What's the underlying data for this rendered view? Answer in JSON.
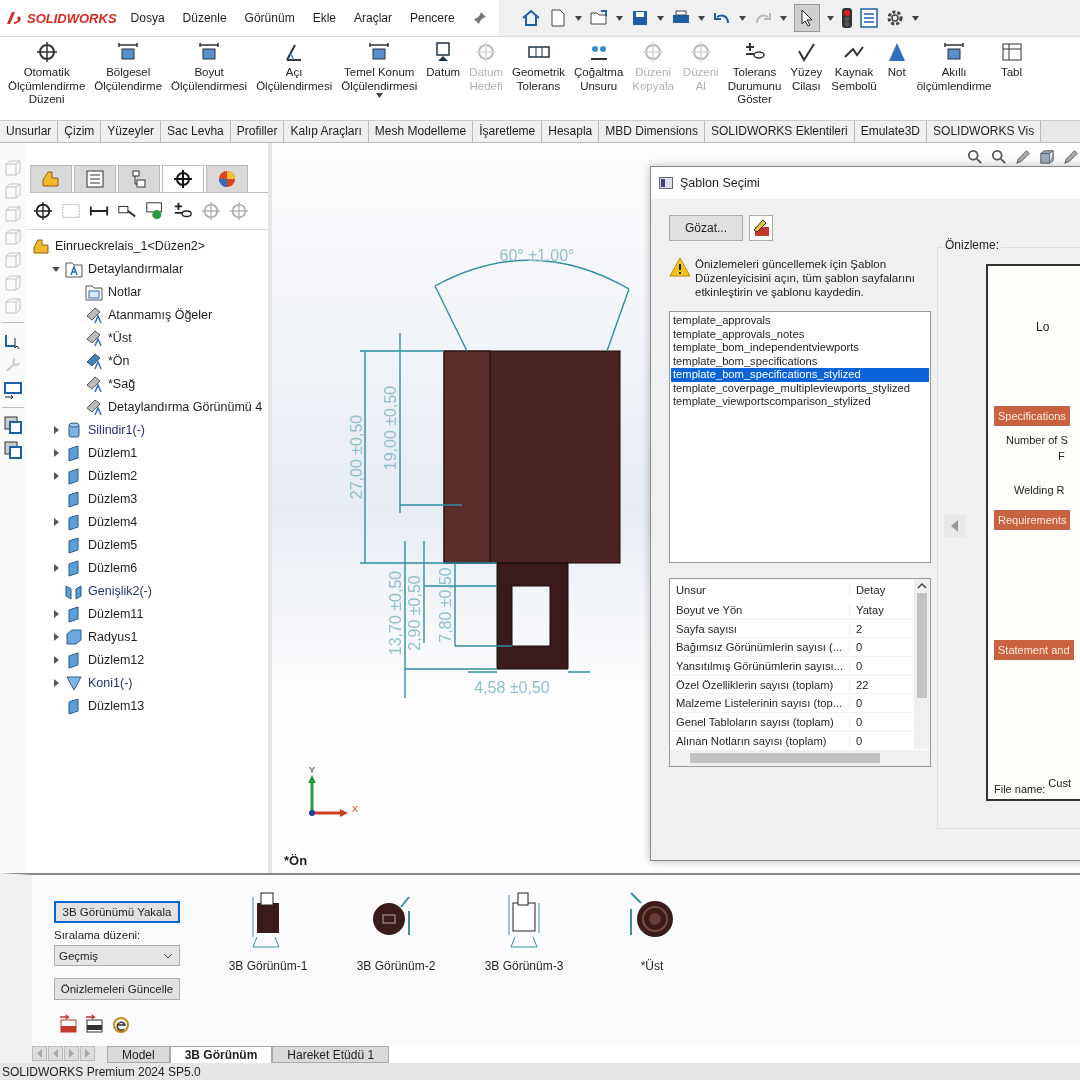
{
  "app": {
    "logo": "SOLIDWORKS",
    "menu": [
      "Dosya",
      "Düzenle",
      "Görünüm",
      "Ekle",
      "Araçlar",
      "Pencere"
    ]
  },
  "ribbon": [
    {
      "label": "Otomatik\nÖlçümlendirme\nDüzeni",
      "disabled": false,
      "dropdown": false
    },
    {
      "label": "Bölgesel\nÖlçülendirme",
      "disabled": false,
      "dropdown": false
    },
    {
      "label": "Boyut\nÖlçülendirmesi",
      "disabled": false,
      "dropdown": false
    },
    {
      "label": "Açı\nÖlçülendirmesi",
      "disabled": false,
      "dropdown": false
    },
    {
      "label": "Temel Konum\nÖlçülendirmesi",
      "disabled": false,
      "dropdown": true
    },
    {
      "label": "Datum",
      "disabled": false,
      "dropdown": false
    },
    {
      "label": "Datum\nHedefi",
      "disabled": true,
      "dropdown": false
    },
    {
      "label": "Geometrik\nTolerans",
      "disabled": false,
      "dropdown": false
    },
    {
      "label": "Çoğaltma\nUnsuru",
      "disabled": false,
      "dropdown": false
    },
    {
      "label": "Düzeni\nKopyala",
      "disabled": true,
      "dropdown": false
    },
    {
      "label": "Düzeni\nAl",
      "disabled": true,
      "dropdown": false
    },
    {
      "label": "Tolerans\nDurumunu\nGöster",
      "disabled": false,
      "dropdown": false
    },
    {
      "label": "Yüzey\nCilası",
      "disabled": false,
      "dropdown": false
    },
    {
      "label": "Kaynak\nSembolü",
      "disabled": false,
      "dropdown": false
    },
    {
      "label": "Not",
      "disabled": false,
      "dropdown": false
    },
    {
      "label": "Akıllı\nölçümlendirme",
      "disabled": false,
      "dropdown": false
    },
    {
      "label": "Tabl",
      "disabled": false,
      "dropdown": false
    }
  ],
  "tabs": [
    "Unsurlar",
    "Çizim",
    "Yüzeyler",
    "Sac Levha",
    "Profiller",
    "Kalıp Araçları",
    "Mesh Modelleme",
    "İşaretleme",
    "Hesapla",
    "MBD Dimensions",
    "SOLIDWORKS Eklentileri",
    "Emulate3D",
    "SOLIDWORKS Vis"
  ],
  "panel_tabs": [
    {
      "selected": false
    },
    {
      "selected": false
    },
    {
      "selected": false
    },
    {
      "selected": true
    },
    {
      "selected": false
    }
  ],
  "tree": {
    "label": "Einrueckrelais_1<Düzen2>",
    "children": [
      {
        "label": "Detaylandırmalar",
        "kind": "annotations",
        "color": "#1e1e1e",
        "expandable": true,
        "expanded": true,
        "children": [
          {
            "label": "Notlar",
            "kind": "notes"
          },
          {
            "label": "Atanmamış Öğeler",
            "kind": "annotation-view",
            "active": false
          },
          {
            "label": "*Üst",
            "kind": "annotation-view",
            "active": false
          },
          {
            "label": "*Ön",
            "kind": "annotation-view",
            "active": true
          },
          {
            "label": "*Sağ",
            "kind": "annotation-view",
            "active": false
          },
          {
            "label": "Detaylandırma Görünümü 4",
            "kind": "annotation-view",
            "active": false
          }
        ]
      },
      {
        "label": "Silindir1(-)",
        "kind": "cylinder",
        "color": "#27307a",
        "expandable": true,
        "expanded": false
      },
      {
        "label": "Düzlem1",
        "kind": "plane",
        "color": "#1e1e1e",
        "expandable": true,
        "expanded": false
      },
      {
        "label": "Düzlem2",
        "kind": "plane",
        "color": "#1e1e1e",
        "expandable": true,
        "expanded": false
      },
      {
        "label": "Düzlem3",
        "kind": "plane",
        "color": "#1e1e1e",
        "expandable": false
      },
      {
        "label": "Düzlem4",
        "kind": "plane",
        "color": "#1e1e1e",
        "expandable": true,
        "expanded": false
      },
      {
        "label": "Düzlem5",
        "kind": "plane",
        "color": "#1e1e1e",
        "expandable": false
      },
      {
        "label": "Düzlem6",
        "kind": "plane",
        "color": "#1e1e1e",
        "expandable": true,
        "expanded": false
      },
      {
        "label": "Genişlik2(-)",
        "kind": "width",
        "color": "#27307a",
        "expandable": false
      },
      {
        "label": "Düzlem11",
        "kind": "plane",
        "color": "#1e1e1e",
        "expandable": true,
        "expanded": false
      },
      {
        "label": "Radyus1",
        "kind": "fillet",
        "color": "#1e1e1e",
        "expandable": true,
        "expanded": false
      },
      {
        "label": "Düzlem12",
        "kind": "plane",
        "color": "#1e1e1e",
        "expandable": true,
        "expanded": false
      },
      {
        "label": "Koni1(-)",
        "kind": "cone",
        "color": "#27307a",
        "expandable": true,
        "expanded": false
      },
      {
        "label": "Düzlem13",
        "kind": "plane",
        "color": "#1e1e1e",
        "expandable": false
      }
    ]
  },
  "viewport": {
    "view_label": "*Ön",
    "axes": [
      "Y",
      "X"
    ],
    "dimensions": {
      "angle": "60° ±1,00°",
      "height_total": "27,00 ±0,50",
      "height_upper": "19,00 ±0,50",
      "tab_total": "13,70 ±0,50",
      "tab_top": "2,90 ±0,50",
      "tab_hole": "7,80 ±0,50",
      "tab_width": "4,58 ±0,50"
    }
  },
  "dialog": {
    "title": "Şablon Seçimi",
    "browse": "Gözat...",
    "warning": "Önizlemeleri güncellemek için Şablon Düzenleyicisini açın, tüm şablon sayfalarını etkinleştirin ve şablonu kaydedin.",
    "templates": [
      {
        "label": "template_approvals",
        "selected": false
      },
      {
        "label": "template_approvals_notes",
        "selected": false
      },
      {
        "label": "template_bom_independentviewports",
        "selected": false
      },
      {
        "label": "template_bom_specifications",
        "selected": false
      },
      {
        "label": "template_bom_specifications_stylized",
        "selected": true
      },
      {
        "label": "template_coverpage_multipleviewports_stylized",
        "selected": false
      },
      {
        "label": "template_viewportscomparison_stylized",
        "selected": false
      }
    ],
    "table": {
      "columns": [
        "Unsur",
        "Detay"
      ],
      "rows": [
        [
          "Boyut ve Yön",
          "Yatay"
        ],
        [
          "Sayfa sayısı",
          "2"
        ],
        [
          "Bağımsız Görünümlerin sayısı (...",
          "0"
        ],
        [
          "Yansıtılmış Görünümlerin sayısı...",
          "0"
        ],
        [
          "Özel Özelliklerin sayısı (toplam)",
          "22"
        ],
        [
          "Malzeme Listelerinin sayısı (top...",
          "0"
        ],
        [
          "Genel Tabloların sayısı (toplam)",
          "0"
        ],
        [
          "Alınan Notların sayısı (toplam)",
          "0"
        ]
      ]
    },
    "preview": {
      "label": "Önizleme:",
      "title_part": "Lo",
      "sections": [
        {
          "header": "Specifications",
          "lines": [
            "Number of S",
            "F",
            "Welding R"
          ]
        },
        {
          "header": "Requirements"
        },
        {
          "header": "Statement and"
        }
      ],
      "file_label": "File name:",
      "file_value": "Cust"
    }
  },
  "views_panel": {
    "capture": "3B Görünümü Yakala",
    "sort_label": "Sıralama düzeni:",
    "sort_value": "Geçmiş",
    "update": "Önizlemeleri Güncelle",
    "views": [
      "3B Görünüm-1",
      "3B Görünüm-2",
      "3B Görünüm-3",
      "*Üst"
    ]
  },
  "bottom_tabs": [
    {
      "label": "Model",
      "selected": false
    },
    {
      "label": "3B Görünüm",
      "selected": true
    },
    {
      "label": "Hareket Etüdü 1",
      "selected": false
    }
  ],
  "status_bar": "SOLIDWORKS Premium 2024 SP5.0"
}
